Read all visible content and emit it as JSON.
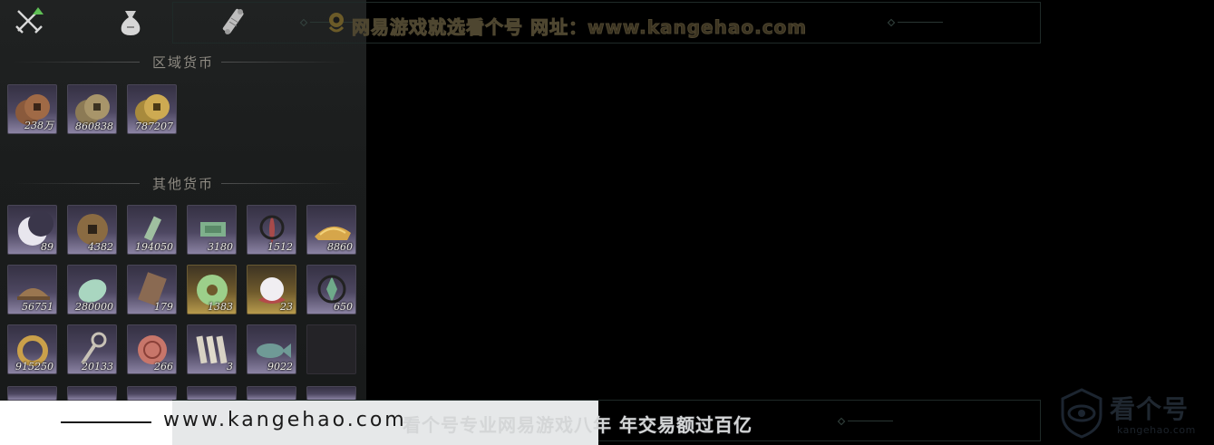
{
  "tabs": [
    {
      "name": "crossed-swords",
      "active": true
    },
    {
      "name": "money-bag"
    },
    {
      "name": "scroll"
    }
  ],
  "regional_currency": {
    "title": "区域货币",
    "items": [
      {
        "icon": "copper-coins-icon",
        "count": "238万"
      },
      {
        "icon": "bronze-coins-icon",
        "count": "860838"
      },
      {
        "icon": "gold-coins-icon",
        "count": "787207"
      }
    ]
  },
  "other_currency": {
    "title": "其他货币",
    "items": [
      {
        "icon": "crescent-moon-icon",
        "count": "89"
      },
      {
        "icon": "ancient-coin-icon",
        "count": "4382"
      },
      {
        "icon": "jade-token-icon",
        "count": "194050"
      },
      {
        "icon": "green-banknote-icon",
        "count": "3180"
      },
      {
        "icon": "red-feather-icon",
        "count": "1512"
      },
      {
        "icon": "gold-pile-icon",
        "count": "8860"
      },
      {
        "icon": "copper-ingot-icon",
        "count": "56751"
      },
      {
        "icon": "jade-stone-icon",
        "count": "280000"
      },
      {
        "icon": "bronze-plaque-icon",
        "count": "179"
      },
      {
        "icon": "jade-disc-icon",
        "count": "1383",
        "rarity": "gold"
      },
      {
        "icon": "pearl-icon",
        "count": "23",
        "rarity": "gold"
      },
      {
        "icon": "green-crystal-icon",
        "count": "650"
      },
      {
        "icon": "gold-bracelet-icon",
        "count": "915250"
      },
      {
        "icon": "key-token-icon",
        "count": "20133"
      },
      {
        "icon": "red-coin-icon",
        "count": "266"
      },
      {
        "icon": "bamboo-slips-icon",
        "count": "3"
      },
      {
        "icon": "jade-fish-icon",
        "count": "9022"
      },
      {
        "icon": "empty-slot",
        "count": ""
      }
    ]
  },
  "watermark": {
    "top_text": "网易游戏就选看个号   网址：www.kangehao.com",
    "bottom_text": "看个号专业网易游戏八年   年交易额过百亿",
    "logo_brand": "看个号",
    "logo_domain": "kangehao.com",
    "url": "www.kangehao.com"
  },
  "colors": {
    "slot_purple": "#4d4761",
    "slot_gold": "#6f5a2c",
    "panel_bg": "#1b1d1d",
    "active_tab_accent": "#5fbf55"
  }
}
